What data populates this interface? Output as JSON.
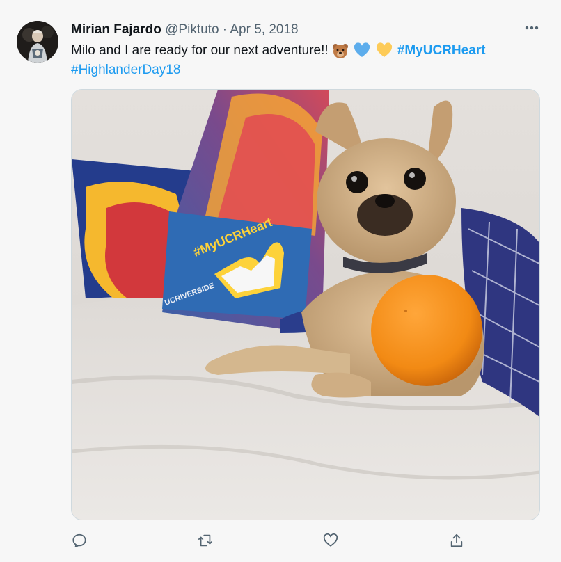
{
  "tweet": {
    "author_name": "Mirian Fajardo",
    "author_handle": "@Piktuto",
    "separator": "·",
    "date": "Apr 5, 2018",
    "text": "Milo and I are ready for our next adventure!!",
    "emojis": [
      "bear-face-icon",
      "blue-heart-icon",
      "yellow-heart-icon"
    ],
    "hashtags": [
      "#MyUCRHeart",
      "#HighlanderDay18"
    ]
  },
  "media": {
    "sign_hashtag": "#MyUCRHeart",
    "sign_brand": "UCRIVERSIDE"
  },
  "actions": [
    "reply-icon",
    "retweet-icon",
    "like-icon",
    "share-icon"
  ],
  "colors": {
    "link": "#1d9bf0",
    "text": "#0f1419",
    "muted": "#536471",
    "icon": "#536471"
  }
}
